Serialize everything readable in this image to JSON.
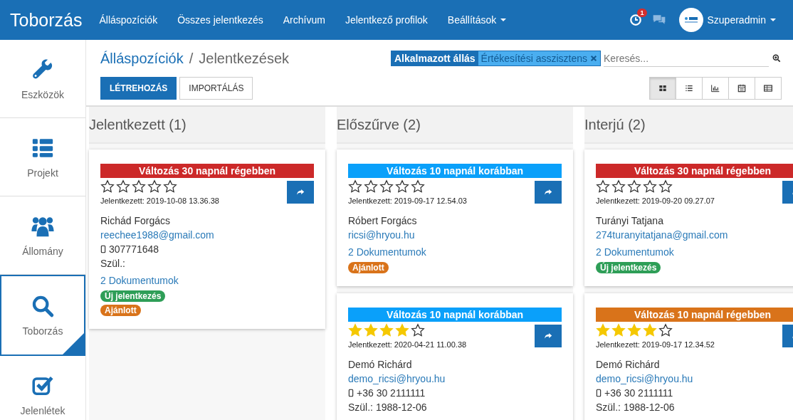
{
  "topbar": {
    "title": "Toborzás",
    "nav": [
      {
        "label": "Álláspozíciók",
        "dropdown": false
      },
      {
        "label": "Összes jelentkezés",
        "dropdown": false
      },
      {
        "label": "Archívum",
        "dropdown": false
      },
      {
        "label": "Jelentkező profilok",
        "dropdown": false
      },
      {
        "label": "Beállítások",
        "dropdown": true
      }
    ],
    "notification_count": "1",
    "user": "Szuperadmin"
  },
  "sidebar": {
    "items": [
      {
        "label": "Eszközök",
        "selected": false
      },
      {
        "label": "Projekt",
        "selected": false
      },
      {
        "label": "Állomány",
        "selected": false
      },
      {
        "label": "Toborzás",
        "selected": true
      },
      {
        "label": "Jelenlétek",
        "selected": false
      }
    ]
  },
  "breadcrumb": [
    "Álláspozíciók",
    "Jelentkezések"
  ],
  "breadcrumb_separator": "/",
  "filter": {
    "label": "Alkalmazott állás",
    "value": "Értékesítési asszisztens"
  },
  "search": {
    "placeholder": "Keresés..."
  },
  "buttons": [
    "LÉTREHOZÁS",
    "IMPORTÁLÁS"
  ],
  "views": [
    {
      "selected": true
    },
    {
      "selected": false
    },
    {
      "selected": false
    },
    {
      "selected": false
    },
    {
      "selected": false
    }
  ],
  "columns": [
    {
      "title": "Jelentkezett (1)",
      "cards": [
        {
          "banner": {
            "text": "Változás 30 napnál régebben",
            "color": "#cc2929"
          },
          "stars": 0,
          "applied": "Jelentkezett: 2019-10-08 13.36.38",
          "name": "Richád Forgács",
          "email": "reechee1988@gmail.com",
          "phone": "307771648",
          "birth": "Szül.:",
          "documents": "2 Dokumentumok",
          "tags": [
            {
              "label": "Új jelentkezés",
              "color": "#2e9e57"
            },
            {
              "label": "Ajánlott",
              "color": "#d9731a"
            }
          ]
        }
      ]
    },
    {
      "title": "Előszűrve (2)",
      "cards": [
        {
          "banner": {
            "text": "Változás 10 napnál korábban",
            "color": "#0aa0fa"
          },
          "stars": 0,
          "applied": "Jelentkezett: 2019-09-17 12.54.03",
          "name": "Róbert Forgács",
          "email": "ricsi@hryou.hu",
          "documents": "2 Dokumentumok",
          "tags": [
            {
              "label": "Ajánlott",
              "color": "#d9731a"
            }
          ]
        },
        {
          "banner": {
            "text": "Változás 10 napnál korábban",
            "color": "#0aa0fa"
          },
          "stars": 4,
          "applied": "Jelentkezett: 2020-04-21 11.00.38",
          "name": "Demó Richárd",
          "email": "demo_ricsi@hryou.hu",
          "phone": "+36 30 2111111",
          "birth": "Szül.: 1988-12-06"
        }
      ]
    },
    {
      "title": "Interjú (2)",
      "cards": [
        {
          "banner": {
            "text": "Változás 30 napnál régebben",
            "color": "#cc2929"
          },
          "stars": 0,
          "applied": "Jelentkezett: 2019-09-20 09.27.07",
          "name": "Turányi Tatjana",
          "email": "274turanyitatjana@gmail.com",
          "documents": "2 Dokumentumok",
          "tags": [
            {
              "label": "Új jelentkezés",
              "color": "#2e9e57"
            }
          ]
        },
        {
          "banner": {
            "text": "Változás 10 napnál régebben",
            "color": "#d9731a"
          },
          "stars": 4,
          "applied": "Jelentkezett: 2019-09-17 12.34.52",
          "name": "Demó Richárd",
          "email": "demo_ricsi@hryou.hu",
          "phone": "+36 30 2111111",
          "birth": "Szül.: 1988-12-06"
        }
      ]
    }
  ]
}
